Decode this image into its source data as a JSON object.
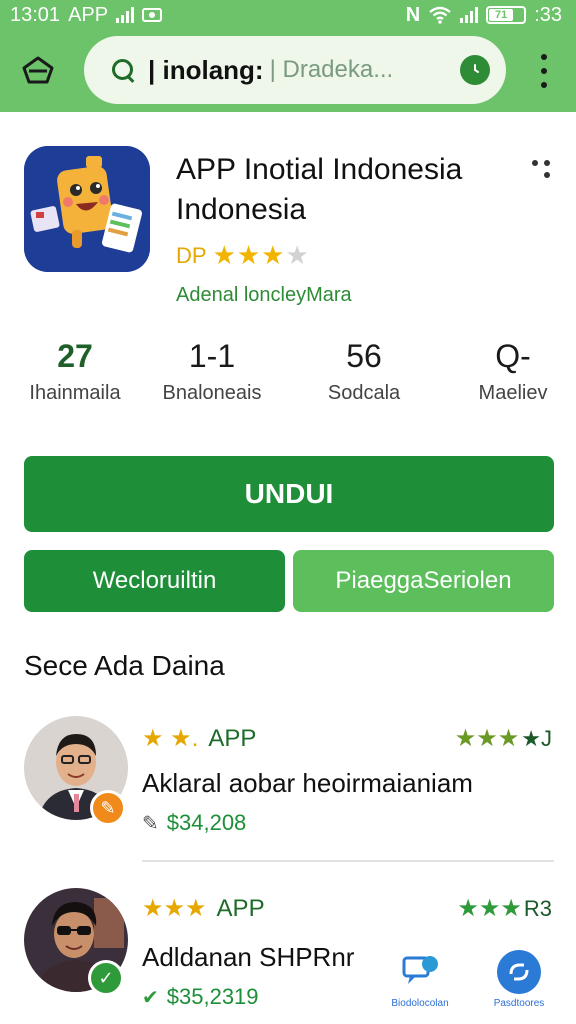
{
  "status_bar": {
    "time": "13:01",
    "app": "APP",
    "battery_level": "71",
    "clock": ":33"
  },
  "search": {
    "query": "| inolang:",
    "placeholder": "| Dradeka..."
  },
  "app": {
    "title": "APP Inotial Indonesia Indonesia",
    "rating_prefix": "DP",
    "rating_stars": 3,
    "developer": "Adenal loncleyMara"
  },
  "stats": [
    {
      "value": "27",
      "label": "Ihainmaila"
    },
    {
      "value": "1‑1",
      "label": "Bnaloneais"
    },
    {
      "value": "56",
      "label": "Sodcala"
    },
    {
      "value": "Q‑",
      "label": "Maeliev"
    }
  ],
  "buttons": {
    "install": "UNDUI",
    "secondary_left": "Wecloruiltin",
    "secondary_right": "PiaeggaSeriolen"
  },
  "section_title": "Sece Ada Daina",
  "reviews": [
    {
      "stars_left": "★ ★.",
      "tag": "APP",
      "stars_right": "★★★",
      "right_num": "★J",
      "text": "Aklaral aobar heoirmaianiam",
      "price": "$34,208"
    },
    {
      "stars_left": "★★★",
      "tag": "APP",
      "stars_right": "★★★",
      "right_num": "R3",
      "text": "Adldanan SHPRnr",
      "price": "$35,2319"
    }
  ],
  "fabs": [
    {
      "label": "Biodolocolan",
      "icon": "chat-icon"
    },
    {
      "label": "Pasdtoores",
      "icon": "sync-icon"
    }
  ],
  "colors": {
    "brand_green": "#1e8f38",
    "topbar_green": "#6cc36a",
    "star_gold": "#f2b400",
    "app_icon_bg": "#1d3d97"
  }
}
